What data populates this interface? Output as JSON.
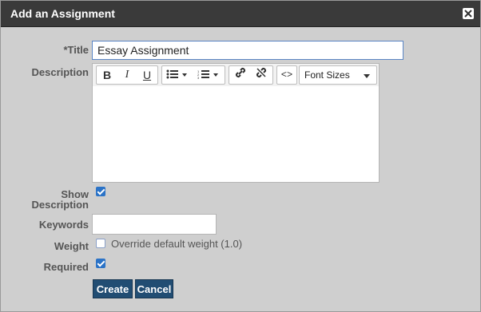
{
  "dialog": {
    "title": "Add an Assignment",
    "close_icon": "close-icon"
  },
  "fields": {
    "title_label": "*Title",
    "title_value": "Essay Assignment",
    "description_label": "Description",
    "show_description_label_line1": "Show",
    "show_description_label_line2": "Description",
    "keywords_label": "Keywords",
    "keywords_value": "",
    "weight_label": "Weight",
    "override_label": "Override default weight (1.0)",
    "required_label": "Required"
  },
  "editor": {
    "bold": "B",
    "italic": "I",
    "underline": "U",
    "font_sizes_label": "Font Sizes",
    "icons": [
      "bold-icon",
      "italic-icon",
      "underline-icon",
      "unordered-list-icon",
      "ordered-list-icon",
      "link-icon",
      "unlink-icon",
      "code-icon"
    ]
  },
  "state": {
    "show_description_checked": true,
    "override_weight_checked": false,
    "required_checked": true
  },
  "actions": {
    "create": "Create",
    "cancel": "Cancel"
  },
  "colors": {
    "title_bar": "#3a3a3a",
    "dialog_bg": "#cfcfcf",
    "primary_button": "#214d73",
    "checkbox_checked": "#2b73c7"
  }
}
